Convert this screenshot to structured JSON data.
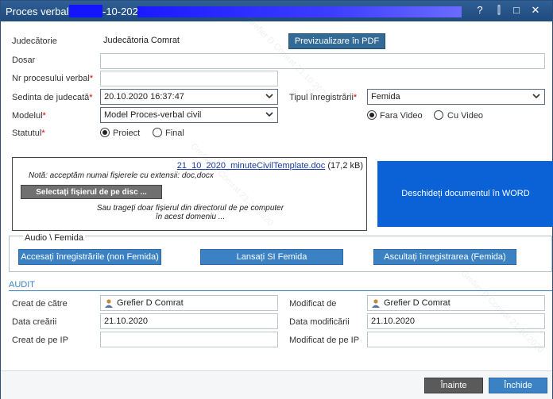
{
  "window": {
    "title_prefix": "Proces verbal:",
    "title_suffix": "-10-2020",
    "buttons": {
      "help": "?",
      "pin": "⫿",
      "maximize": "□",
      "close": "✕"
    }
  },
  "form": {
    "judecatorie": {
      "label": "Judecătorie",
      "value": "Judecătoria Comrat"
    },
    "preview_button": "Previzualizare în PDF",
    "dosar": {
      "label": "Dosar",
      "value": ""
    },
    "nr_proces": {
      "label": "Nr procesului verbal",
      "value": ""
    },
    "sedinta": {
      "label": "Sedinta de judecată",
      "value": "20.10.2020 16:37:47"
    },
    "tip_inreg": {
      "label": "Tipul înregistrării",
      "value": "Femida"
    },
    "modelul": {
      "label": "Modelul",
      "value": "Model Proces-verbal civil"
    },
    "video": {
      "fara": "Fara Video",
      "cu": "Cu Video",
      "selected": "fara"
    },
    "statutul": {
      "label": "Statutul",
      "proiect": "Proiect",
      "final": "Final",
      "selected": "proiect"
    }
  },
  "upload": {
    "file_link": "21_10_2020_minuteCivilTemplate.doc",
    "file_size": "(17,2 kB)",
    "note": "Notă: acceptăm numai fișierele cu extensii: doc,docx",
    "select_button": "Selectați fișierul de pe disc ...",
    "drop_line1": "Sau trageți doar fișierul din directorul de pe computer",
    "drop_line2": "în acest domeniu ..."
  },
  "word_button": "Deschideți documentul în WORD",
  "audio": {
    "legend": "Audio \\ Femida",
    "btn_access": "Accesați înregistrările (non Femida)",
    "btn_launch": "Lansați SI Femida",
    "btn_listen": "Ascultați înregistrarea (Femida)"
  },
  "audit": {
    "title": "AUDIT",
    "creat_de": {
      "label": "Creat de către",
      "value": "Grefier D Comrat"
    },
    "modificat_de": {
      "label": "Modificat de",
      "value": "Grefier D Comrat"
    },
    "data_crearii": {
      "label": "Data creării",
      "value": "21.10.2020"
    },
    "data_modif": {
      "label": "Data modificării",
      "value": "21.10.2020"
    },
    "creat_ip": {
      "label": "Creat de pe IP",
      "value": ""
    },
    "modif_ip": {
      "label": "Modificat de pe IP",
      "value": ""
    }
  },
  "footer": {
    "next": "Înainte",
    "close": "Închide"
  },
  "watermark": "Grefier D Comrat 21.10.2020",
  "colors": {
    "titlebar": "#1f4a7d",
    "accent": "#3b82c4",
    "word_button": "#0a62d6",
    "required": "#dd0000"
  },
  "icons": [
    "user-icon",
    "chevron-down-icon"
  ]
}
